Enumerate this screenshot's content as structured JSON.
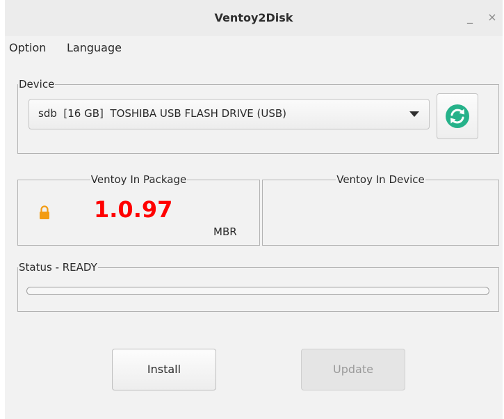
{
  "window": {
    "title": "Ventoy2Disk",
    "minimize_glyph": "_",
    "close_glyph": "×"
  },
  "menu": {
    "option_label": "Option",
    "language_label": "Language"
  },
  "device": {
    "group_label": "Device",
    "selected": "sdb  [16 GB]  TOSHIBA USB FLASH DRIVE (USB)",
    "refresh_icon": "refresh-icon",
    "refresh_color": "#26b28a"
  },
  "package": {
    "group_label": "Ventoy In Package",
    "version": "1.0.97",
    "version_color": "#ff0000",
    "partition_style": "MBR",
    "lock_icon": "lock-icon",
    "lock_color": "#f39c12"
  },
  "device_info": {
    "group_label": "Ventoy In Device"
  },
  "status": {
    "group_label": "Status - READY",
    "progress_percent": 0
  },
  "actions": {
    "install_label": "Install",
    "update_label": "Update",
    "update_enabled": false
  }
}
